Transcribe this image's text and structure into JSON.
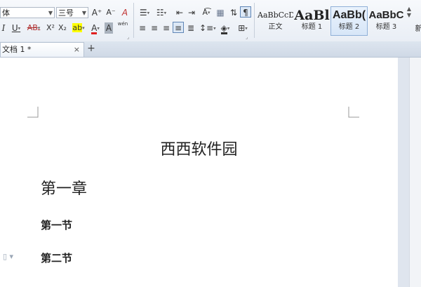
{
  "ribbon": {
    "font_name": "体",
    "font_size": "三号",
    "grow_font_icon": "A⁺",
    "shrink_font_icon": "A⁻",
    "clear_format_icon": "A",
    "italic": "I",
    "underline": "U",
    "strikethrough": "AB",
    "superscript": "X²",
    "subscript": "X₂",
    "highlight": "ab",
    "font_color": "A",
    "char_shading": "A",
    "phonetic": "wén",
    "style_samples": [
      {
        "sample": "AaBbCcDd",
        "name": "正文"
      },
      {
        "sample": "AaBl",
        "name": "标题 1"
      },
      {
        "sample": "AaBb(",
        "name": "标题 2"
      },
      {
        "sample": "AaBbC",
        "name": "标题 3"
      }
    ],
    "new_style_label": "新"
  },
  "colors": {
    "highlight": "#ffff00",
    "font_color": "#e02020",
    "char_shading_bg": "#a9b2bd",
    "selected_style": "#d7e6f8"
  },
  "tabs": {
    "document_tab": "文档 1 *",
    "close_icon": "×",
    "new_tab_icon": "+"
  },
  "document": {
    "title": "西西软件园",
    "chapter": "第一章",
    "section_1": "第一节",
    "section_2": "第二节"
  }
}
